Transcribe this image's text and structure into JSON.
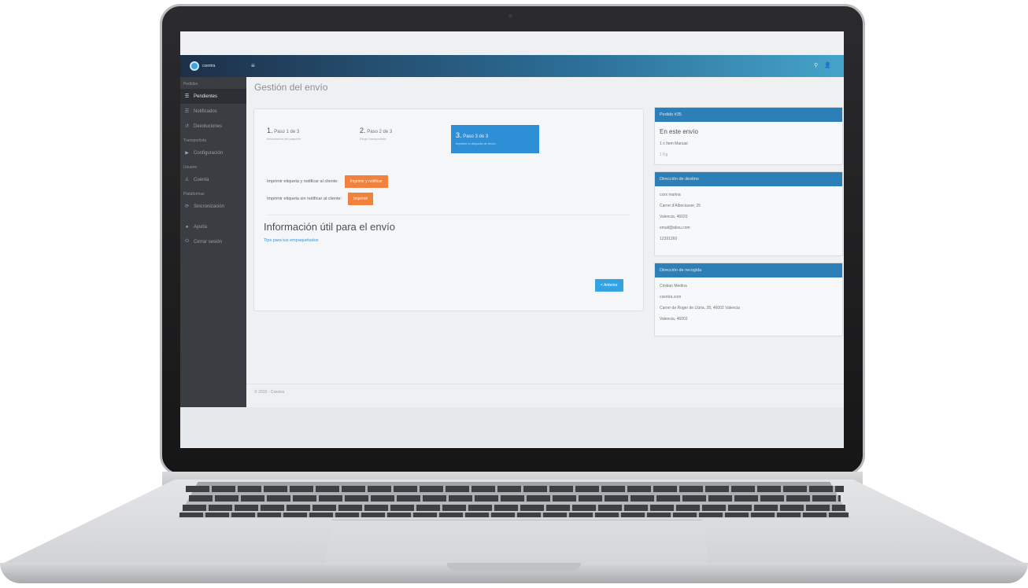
{
  "app": {
    "brand": "cxentra",
    "page_title": "Gestión del envío",
    "footer": "© 2019 - Cxentra"
  },
  "topbar": {
    "menu_icon": "hamburger-icon",
    "search_icon": "search-icon",
    "user_icon": "user-icon"
  },
  "sidebar": {
    "sections": [
      {
        "title": "Pedidos",
        "items": [
          {
            "label": "Pendientes",
            "icon": "list-icon",
            "active": true
          },
          {
            "label": "Notificados",
            "icon": "bell-icon"
          },
          {
            "label": "Devoluciones",
            "icon": "undo-icon"
          }
        ]
      },
      {
        "title": "Transportista",
        "items": [
          {
            "label": "Configuración",
            "icon": "truck-icon"
          }
        ]
      },
      {
        "title": "Usuario",
        "items": [
          {
            "label": "Cuenta",
            "icon": "user-icon"
          }
        ]
      },
      {
        "title": "Plataformas",
        "items": [
          {
            "label": "Sincronización",
            "icon": "sync-icon"
          }
        ]
      },
      {
        "title": "",
        "items": [
          {
            "label": "Ayuda",
            "icon": "help-icon"
          },
          {
            "label": "Cerrar sesión",
            "icon": "power-icon"
          }
        ]
      }
    ]
  },
  "steps": [
    {
      "num": "1.",
      "label": "Paso 1 de 3",
      "sub": "Información del paquete"
    },
    {
      "num": "2.",
      "label": "Paso 2 de 3",
      "sub": "Elegir transportista"
    },
    {
      "num": "3.",
      "label": "Paso 3 de 3",
      "sub": "Imprime tu etiqueta de envío",
      "active": true
    }
  ],
  "actions": {
    "row1_label": "Imprimir etiqueta y notificar al cliente:",
    "row1_button": "Imprimir y notificar",
    "row2_label": "Imprimir etiqueta sin notificar al cliente:",
    "row2_button": "Imprimir"
  },
  "info": {
    "title": "Información útil para el envío",
    "link": "Tips para tus empaquetados",
    "back_button": "< Anterior"
  },
  "panels": {
    "order": {
      "title": "Pedido #35",
      "heading": "En este envío",
      "item": "1 x Item Manual",
      "weight": "1 Kg"
    },
    "destination": {
      "title": "Dirección de destino",
      "lines": [
        "cxxx marina",
        "Carrer d'Albocàsser, 25",
        "Valencia, 46020",
        "email@abxu.com",
        "12391260"
      ]
    },
    "pickup": {
      "title": "Dirección de recogida",
      "lines": [
        "Cristian Medina",
        "cxentra.com",
        "Carrer de Roger de Llúria, 28, 46002 Valencia",
        "Valencia, 46002"
      ]
    }
  },
  "colors": {
    "accent_blue": "#2f8fd6",
    "orange": "#f0813f",
    "sidebar": "#3a3d42"
  }
}
